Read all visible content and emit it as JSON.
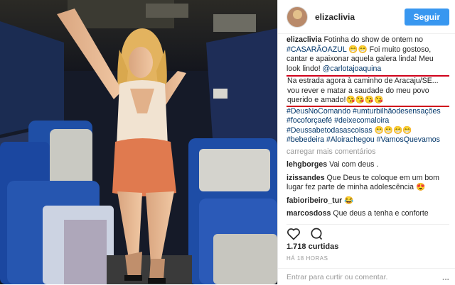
{
  "header": {
    "username": "elizaclivia",
    "follow_label": "Seguir"
  },
  "caption": {
    "username": "elizaclivia",
    "text_1": "Fotinha do show de ontem no",
    "tag_1": "#CASARÃOAZUL",
    "text_2": "😁😁 Foi muito gostoso, cantar e apaixonar aquela galera linda! Meu look lindo!",
    "mention": "@carlotajoaquina",
    "boxed_text": "Na estrada agora à caminho de Aracaju/SE... vou rever e matar a saudade do meu povo querido e amado!😘😘😘😘",
    "hashtags": "#DeusNoComando #umturbilhãodesensações #focoforçaefé #deixecomaloira #Deussabetodasascoisas 😁😁😁😁 #bebedeira #Aloirachegou #VamosQuevamos"
  },
  "load_more_label": "carregar mais comentários",
  "comments": [
    {
      "user": "lehgborges",
      "text": "Vai com deus ."
    },
    {
      "user": "izissandes",
      "text": "Que Deus te coloque em um bom lugar fez parte de minha adolescência 😍"
    },
    {
      "user": "fabioribeiro_tur",
      "text": "😂"
    },
    {
      "user": "marcosdoss",
      "text": "Que deus a tenha e conforte"
    }
  ],
  "icons": {
    "like": "heart-icon",
    "comment": "comment-icon"
  },
  "likes_text": "1.718 curtidas",
  "time_text": "HÁ 18 HORAS",
  "footer": {
    "login_label": "Entrar",
    "prompt": "para curtir ou comentar.",
    "more_label": "..."
  },
  "colors": {
    "accent": "#3897f0",
    "highlight_box": "#d0021b",
    "link": "#003569"
  }
}
